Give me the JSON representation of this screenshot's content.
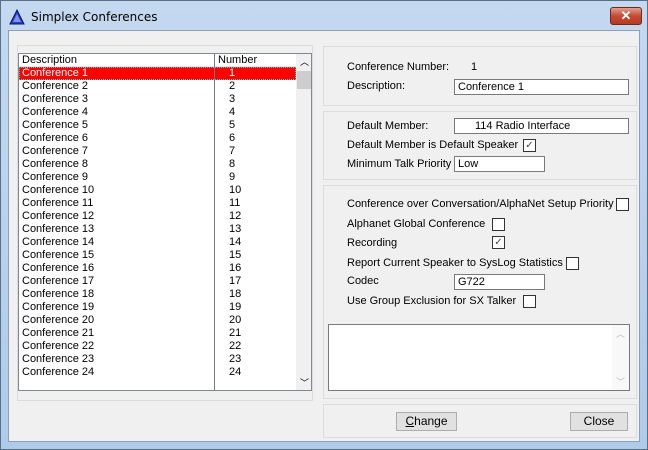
{
  "window": {
    "title": "Simplex Conferences",
    "close": "✕"
  },
  "list": {
    "headers": [
      "Description",
      "Number"
    ],
    "rows": [
      [
        "Conference 1",
        "1"
      ],
      [
        "Conference 2",
        "2"
      ],
      [
        "Conference 3",
        "3"
      ],
      [
        "Conference 4",
        "4"
      ],
      [
        "Conference 5",
        "5"
      ],
      [
        "Conference 6",
        "6"
      ],
      [
        "Conference 7",
        "7"
      ],
      [
        "Conference 8",
        "8"
      ],
      [
        "Conference 9",
        "9"
      ],
      [
        "Conference 10",
        "10"
      ],
      [
        "Conference 11",
        "11"
      ],
      [
        "Conference 12",
        "12"
      ],
      [
        "Conference 13",
        "13"
      ],
      [
        "Conference 14",
        "14"
      ],
      [
        "Conference 15",
        "15"
      ],
      [
        "Conference 16",
        "16"
      ],
      [
        "Conference 17",
        "17"
      ],
      [
        "Conference 18",
        "18"
      ],
      [
        "Conference 19",
        "19"
      ],
      [
        "Conference 20",
        "20"
      ],
      [
        "Conference 21",
        "21"
      ],
      [
        "Conference 22",
        "22"
      ],
      [
        "Conference 23",
        "23"
      ],
      [
        "Conference 24",
        "24"
      ]
    ],
    "selected_index": 0
  },
  "details": {
    "conf_number_label": "Conference Number:",
    "conf_number": "1",
    "description_label": "Description:",
    "description": "Conference 1",
    "default_member_label": "Default Member:",
    "default_member": "114 Radio Interface",
    "default_speaker_label": "Default Member is Default Speaker",
    "default_speaker": true,
    "min_priority_label": "Minimum Talk Priority",
    "min_priority": "Low",
    "conv_priority_label": "Conference over Conversation/AlphaNet Setup Priority",
    "conv_priority": false,
    "alphanet_label": "Alphanet Global Conference",
    "alphanet": false,
    "recording_label": "Recording",
    "recording": true,
    "report_label": "Report Current Speaker to SysLog Statistics",
    "report": false,
    "codec_label": "Codec",
    "codec": "G722",
    "group_excl_label": "Use Group Exclusion for SX Talker",
    "group_excl": false
  },
  "buttons": {
    "change": "Change",
    "close": "Close"
  }
}
